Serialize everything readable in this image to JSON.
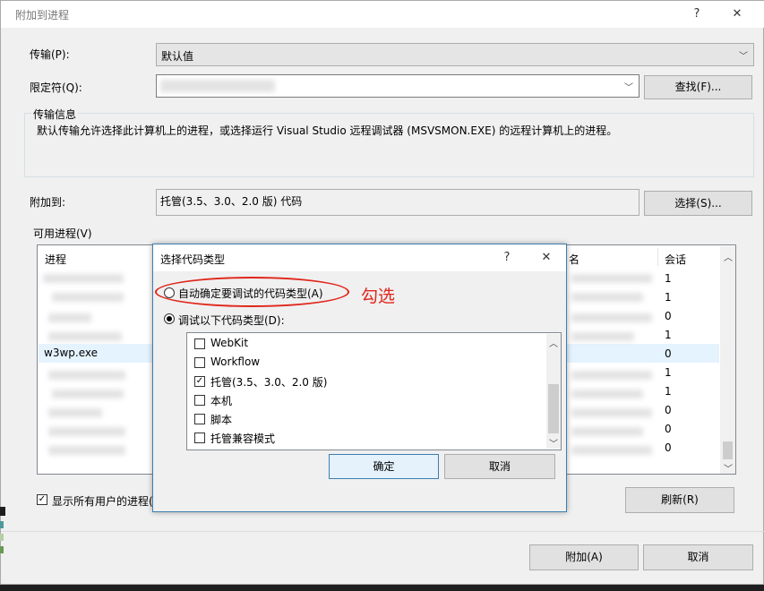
{
  "window": {
    "title": "附加到进程",
    "help_label": "?",
    "close_label": "✕"
  },
  "transport": {
    "label": "传输(P):",
    "value": "默认值"
  },
  "qualifier": {
    "label": "限定符(Q):",
    "find_button": "查找(F)..."
  },
  "transport_info": {
    "title": "传输信息",
    "text": "默认传输允许选择此计算机上的进程，或选择运行 Visual Studio 远程调试器 (MSVSMON.EXE) 的远程计算机上的进程。"
  },
  "attach_to": {
    "label": "附加到:",
    "value": "托管(3.5、3.0、2.0 版) 代码",
    "select_button": "选择(S)..."
  },
  "available_processes": {
    "title": "可用进程(V)",
    "col_process": "进程",
    "col_name_partial": "名",
    "col_session": "会话",
    "visible_process": "w3wp.exe",
    "sessions": [
      "1",
      "1",
      "0",
      "1",
      "0",
      "1",
      "1",
      "0",
      "0",
      "0"
    ]
  },
  "show_all_users": {
    "label": "显示所有用户的进程(",
    "checked": true
  },
  "refresh_button": "刷新(R)",
  "attach_button": "附加(A)",
  "cancel_button": "取消",
  "code_type_dialog": {
    "title": "选择代码类型",
    "help_label": "?",
    "close_label": "✕",
    "auto_option": "自动确定要调试的代码类型(A)",
    "manual_option": "调试以下代码类型(D):",
    "items": [
      {
        "label": "WebKit",
        "checked": false
      },
      {
        "label": "Workflow",
        "checked": false
      },
      {
        "label": "托管(3.5、3.0、2.0 版)",
        "checked": true
      },
      {
        "label": "本机",
        "checked": false
      },
      {
        "label": "脚本",
        "checked": false
      },
      {
        "label": "托管兼容模式",
        "checked": false
      }
    ],
    "ok_button": "确定",
    "cancel_button": "取消"
  },
  "annotation": {
    "text": "勾选",
    "color": "#e0261b"
  },
  "colors": {
    "accent": "#3c7fb1",
    "selection": "#e5f3ff"
  }
}
